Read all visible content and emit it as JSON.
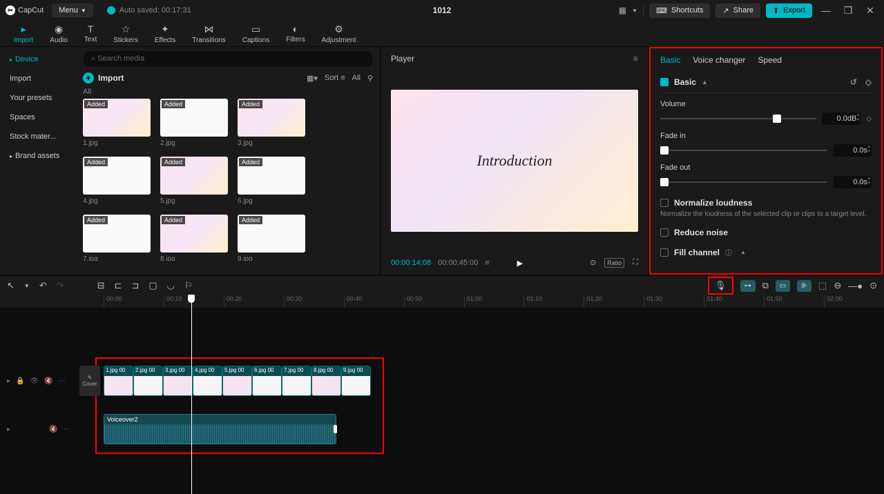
{
  "titlebar": {
    "app_name": "CapCut",
    "menu_label": "Menu",
    "autosave": "Auto saved: 00:17:31",
    "project_title": "1012",
    "shortcuts": "Shortcuts",
    "share": "Share",
    "export": "Export"
  },
  "top_tabs": [
    {
      "label": "Import",
      "active": true
    },
    {
      "label": "Audio"
    },
    {
      "label": "Text"
    },
    {
      "label": "Stickers"
    },
    {
      "label": "Effects"
    },
    {
      "label": "Transitions"
    },
    {
      "label": "Captions"
    },
    {
      "label": "Filters"
    },
    {
      "label": "Adjustment"
    }
  ],
  "sidebar": {
    "items": [
      {
        "label": "Device",
        "active": true,
        "caret": true
      },
      {
        "label": "Import"
      },
      {
        "label": "Your presets"
      },
      {
        "label": "Spaces"
      },
      {
        "label": "Stock mater..."
      },
      {
        "label": "Brand assets",
        "caret": true
      }
    ]
  },
  "media": {
    "search_placeholder": "Search media",
    "import_label": "Import",
    "sort_label": "Sort",
    "all_label": "All",
    "section": "All",
    "added_tag": "Added",
    "items": [
      {
        "name": "1.jpg"
      },
      {
        "name": "2.jpg"
      },
      {
        "name": "3.jpg"
      },
      {
        "name": "4.jpg"
      },
      {
        "name": "5.jpg"
      },
      {
        "name": "6.jpg"
      },
      {
        "name": "7.jpg"
      },
      {
        "name": "8.jpg"
      },
      {
        "name": "9.jpg"
      }
    ]
  },
  "player": {
    "title": "Player",
    "canvas_text": "Introduction",
    "current_time": "00:00:14:08",
    "total_time": "00:00:45:00",
    "ratio": "Ratio"
  },
  "inspector": {
    "tabs": [
      {
        "label": "Basic",
        "active": true
      },
      {
        "label": "Voice changer"
      },
      {
        "label": "Speed"
      }
    ],
    "basic_header": "Basic",
    "volume": {
      "label": "Volume",
      "value": "0.0dB"
    },
    "fade_in": {
      "label": "Fade in",
      "value": "0.0s"
    },
    "fade_out": {
      "label": "Fade out",
      "value": "0.0s"
    },
    "normalize": {
      "label": "Normalize loudness",
      "helper": "Normalize the loudness of the selected clip or clips to a target level."
    },
    "reduce_noise": {
      "label": "Reduce noise"
    },
    "fill_channel": {
      "label": "Fill channel"
    }
  },
  "timeline": {
    "ticks": [
      "00:00",
      "00:10",
      "00:20",
      "00:30",
      "00:40",
      "00:50",
      "01:00",
      "01:10",
      "01:20",
      "01:30",
      "01:40",
      "01:50",
      "02:00"
    ],
    "cover_label": "Cover",
    "clips": [
      {
        "label": "1.jpg  00"
      },
      {
        "label": "2.jpg  00"
      },
      {
        "label": "3.jpg  00"
      },
      {
        "label": "4.jpg  00"
      },
      {
        "label": "5.jpg  00"
      },
      {
        "label": "6.jpg  00"
      },
      {
        "label": "7.jpg  00"
      },
      {
        "label": "8.jpg  00"
      },
      {
        "label": "9.jpg  00"
      }
    ],
    "audio_clip": "Voiceover2"
  }
}
